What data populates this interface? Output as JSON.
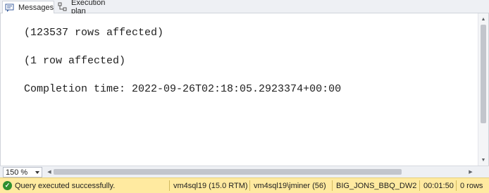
{
  "tabs": [
    {
      "label": "Messages",
      "icon": "messages-icon",
      "active": true
    },
    {
      "label": "Execution plan",
      "icon": "execution-plan-icon",
      "active": false
    }
  ],
  "messages": [
    "(123537 rows affected)",
    "(1 row affected)",
    "Completion time: 2022-09-26T02:18:05.2923374+00:00"
  ],
  "zoom": {
    "value": "150 %"
  },
  "status": {
    "message": "Query executed successfully.",
    "server": "vm4sql19 (15.0 RTM)",
    "user": "vm4sql19\\jminer (56)",
    "database": "BIG_JONS_BBQ_DW2",
    "elapsed": "00:01:50",
    "rows": "0 rows",
    "icon": "success-check-icon",
    "bar_color": "#ffeaa0",
    "icon_color": "#2f8f2f"
  }
}
